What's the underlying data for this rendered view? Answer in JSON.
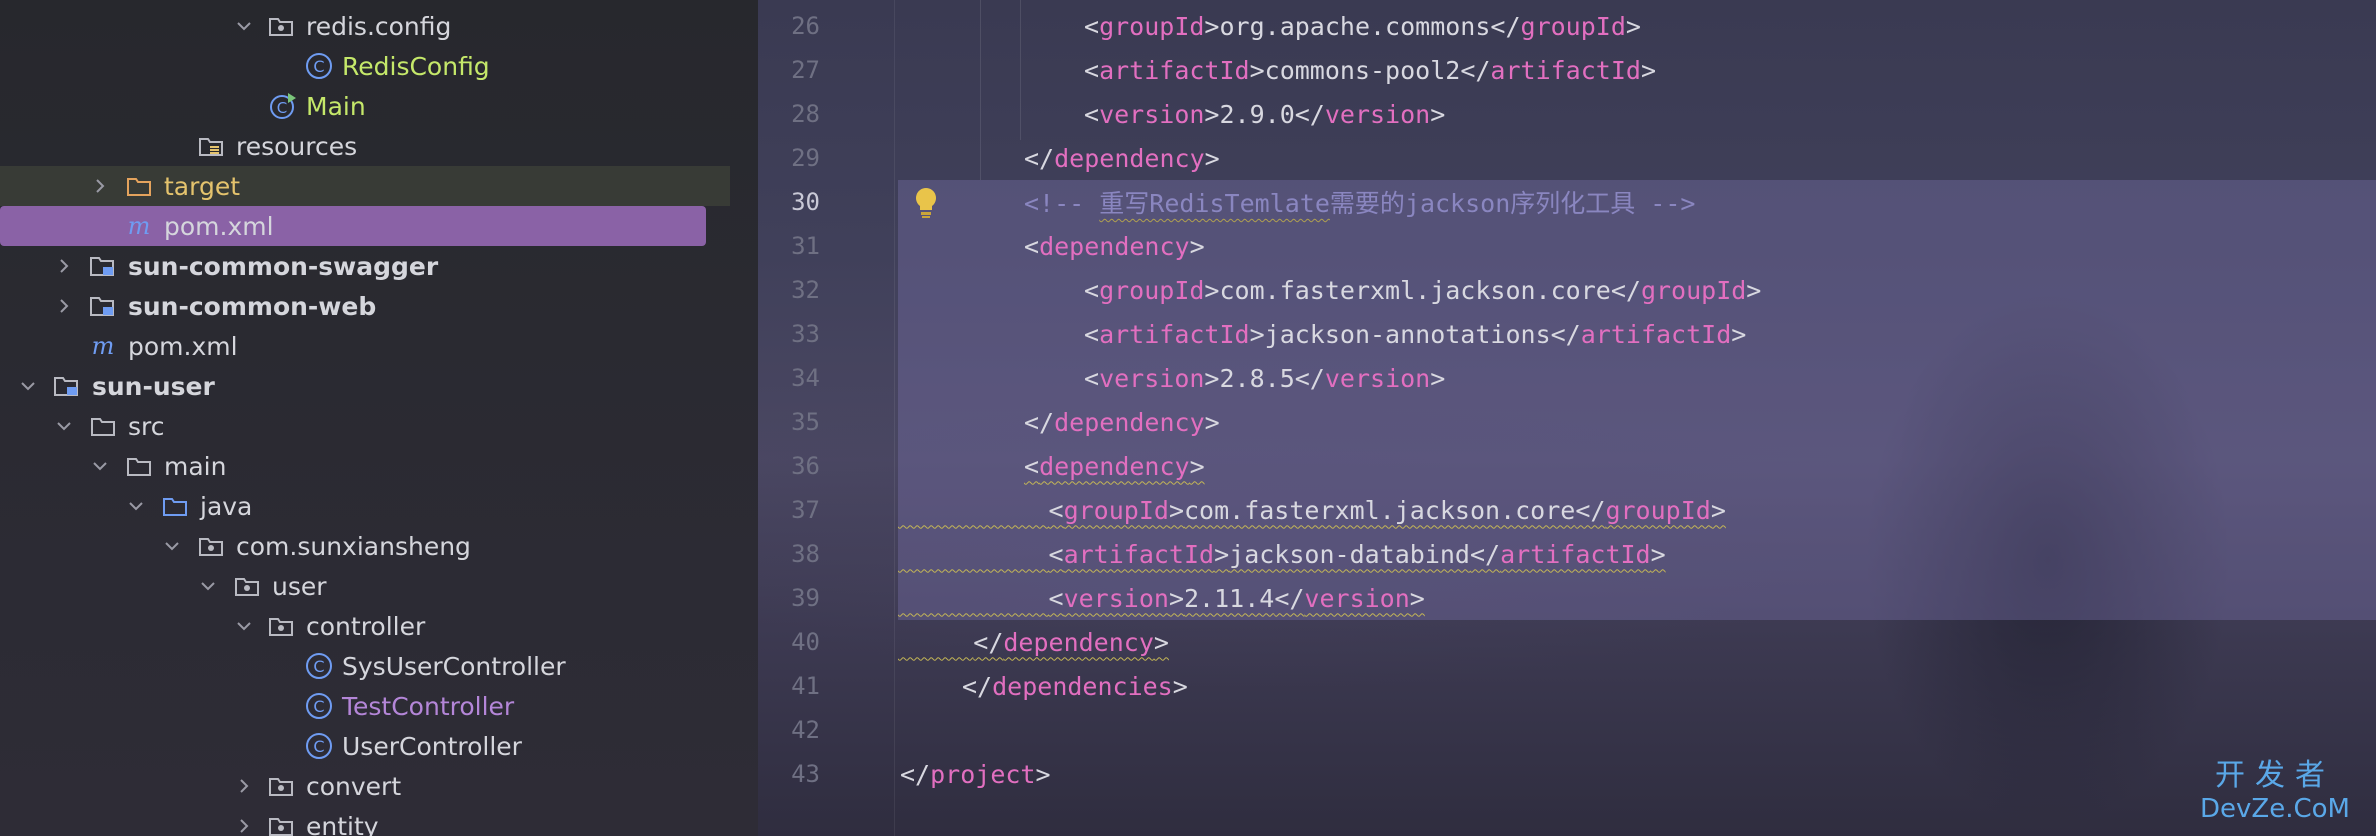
{
  "project_tree": {
    "items": [
      {
        "label": "redis.config",
        "icon": "package-folder-icon"
      },
      {
        "label": "RedisConfig",
        "icon": "class-icon"
      },
      {
        "label": "Main",
        "icon": "class-run-icon"
      },
      {
        "label": "resources",
        "icon": "resources-folder-icon"
      },
      {
        "label": "target",
        "icon": "folder-icon"
      },
      {
        "label": "pom.xml",
        "icon": "maven-icon"
      },
      {
        "label": "sun-common-swagger",
        "icon": "module-folder-icon"
      },
      {
        "label": "sun-common-web",
        "icon": "module-folder-icon"
      },
      {
        "label": "pom.xml",
        "icon": "maven-icon"
      },
      {
        "label": "sun-user",
        "icon": "module-folder-icon"
      },
      {
        "label": "src",
        "icon": "folder-icon"
      },
      {
        "label": "main",
        "icon": "folder-icon"
      },
      {
        "label": "java",
        "icon": "source-folder-icon"
      },
      {
        "label": "com.sunxiansheng",
        "icon": "package-folder-icon"
      },
      {
        "label": "user",
        "icon": "package-folder-icon"
      },
      {
        "label": "controller",
        "icon": "package-folder-icon"
      },
      {
        "label": "SysUserController",
        "icon": "class-icon"
      },
      {
        "label": "TestController",
        "icon": "class-icon"
      },
      {
        "label": "UserController",
        "icon": "class-icon"
      },
      {
        "label": "convert",
        "icon": "package-folder-icon"
      },
      {
        "label": "entity",
        "icon": "package-folder-icon"
      }
    ]
  },
  "editor": {
    "lines": [
      {
        "num": "26",
        "text": "<groupId>org.apache.commons</groupId>"
      },
      {
        "num": "27",
        "text": "<artifactId>commons-pool2</artifactId>"
      },
      {
        "num": "28",
        "text": "<version>2.9.0</version>"
      },
      {
        "num": "29",
        "text": "</dependency>"
      },
      {
        "num": "30",
        "text": "<!-- 重写RedisTemlate需要的jackson序列化工具 -->"
      },
      {
        "num": "31",
        "text": "<dependency>"
      },
      {
        "num": "32",
        "text": "<groupId>com.fasterxml.jackson.core</groupId>"
      },
      {
        "num": "33",
        "text": "<artifactId>jackson-annotations</artifactId>"
      },
      {
        "num": "34",
        "text": "<version>2.8.5</version>"
      },
      {
        "num": "35",
        "text": "</dependency>"
      },
      {
        "num": "36",
        "text": "<dependency>"
      },
      {
        "num": "37",
        "text": "<groupId>com.fasterxml.jackson.core</groupId>"
      },
      {
        "num": "38",
        "text": "<artifactId>jackson-databind</artifactId>"
      },
      {
        "num": "39",
        "text": "<version>2.11.4</version>"
      },
      {
        "num": "40",
        "text": "</dependency>"
      },
      {
        "num": "41",
        "text": "</dependencies>"
      },
      {
        "num": "42",
        "text": ""
      },
      {
        "num": "43",
        "text": "</project>"
      }
    ],
    "current_line": "30"
  },
  "watermark": {
    "top": "开发者",
    "bottom": "DevZe.CoM"
  },
  "colors": {
    "tag": "#e26fc0",
    "comment": "#8a86c0",
    "selection": "#8a62a6",
    "class_green": "#c5e86a",
    "target_yellow": "#e4c36d",
    "icon_blue": "#6f9cf2"
  }
}
